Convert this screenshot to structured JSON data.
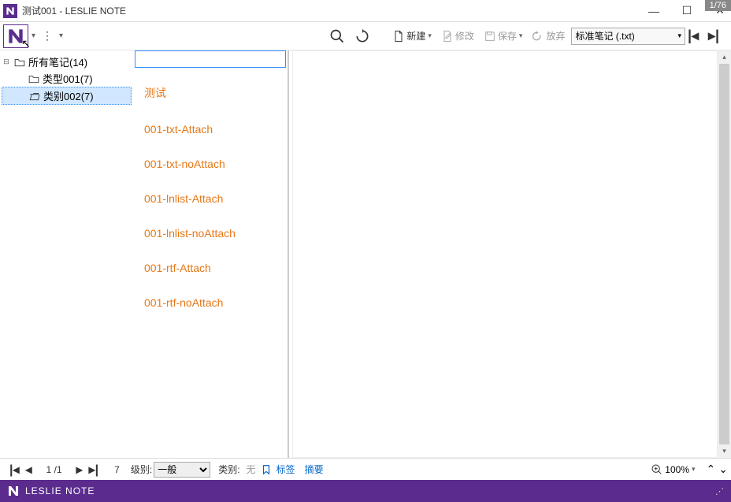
{
  "window": {
    "title": "测试001 - LESLIE NOTE",
    "frame_counter": "1/76"
  },
  "toolbar": {
    "new_label": "新建",
    "modify_label": "修改",
    "save_label": "保存",
    "discard_label": "放弃",
    "type_select_value": "标准笔记 (.txt)"
  },
  "tree": {
    "items": [
      {
        "label": "所有笔记(14)",
        "expanded": true,
        "level": 0
      },
      {
        "label": "类型001(7)",
        "level": 1
      },
      {
        "label": "类别002(7)",
        "level": 1,
        "selected": true
      }
    ]
  },
  "list": {
    "search_value": "",
    "items": [
      "测试",
      "001-txt-Attach",
      "001-txt-noAttach",
      "001-lnlist-Attach",
      "001-lnlist-noAttach",
      "001-rtf-Attach",
      "001-rtf-noAttach"
    ]
  },
  "status": {
    "page_current": "1",
    "page_sep": "/",
    "page_total": "1",
    "count": "7",
    "level_label": "级别:",
    "level_value": "一般",
    "category_label": "类别:",
    "category_value": "无",
    "tag_label": "标签",
    "summary_label": "摘要",
    "zoom": "100%"
  },
  "footer": {
    "brand": "LESLIE NOTE"
  }
}
